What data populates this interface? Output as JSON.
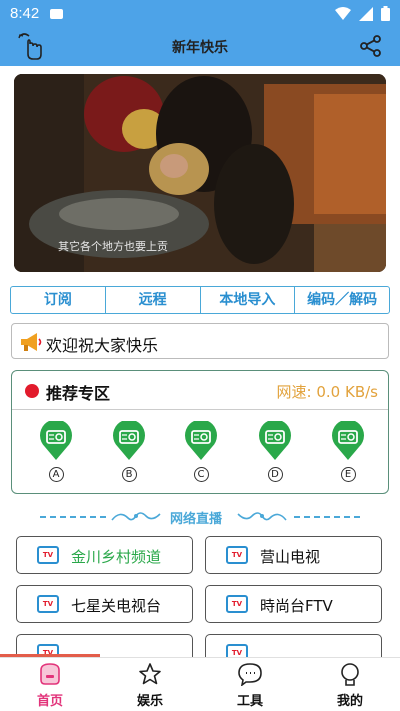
{
  "status": {
    "time": "8:42"
  },
  "app": {
    "title": "新年快乐"
  },
  "video": {
    "subtitle": "其它各个地方也要上贡"
  },
  "tabs": [
    {
      "label": "订阅"
    },
    {
      "label": "远程"
    },
    {
      "label": "本地导入"
    },
    {
      "label": "编码／解码"
    }
  ],
  "notice": {
    "text": "欢迎祝大家快乐"
  },
  "recommend": {
    "title": "推荐专区",
    "speed": "网速: 0.0 KB/s",
    "channels": [
      {
        "letter": "A"
      },
      {
        "letter": "B"
      },
      {
        "letter": "C"
      },
      {
        "letter": "D"
      },
      {
        "letter": "E"
      }
    ]
  },
  "live": {
    "title": "网络直播",
    "channels": [
      {
        "label": "金川乡村频道",
        "active": true
      },
      {
        "label": "营山电视",
        "active": false
      },
      {
        "label": "七星关电视台",
        "active": false
      },
      {
        "label": "時尚台FTV",
        "active": false
      },
      {
        "label": "",
        "active": false
      },
      {
        "label": "",
        "active": false
      }
    ],
    "tv_badge": "TV"
  },
  "nav": [
    {
      "label": "首页",
      "icon": "home-icon",
      "active": true
    },
    {
      "label": "娱乐",
      "icon": "star-icon",
      "active": false
    },
    {
      "label": "工具",
      "icon": "chat-icon",
      "active": false
    },
    {
      "label": "我的",
      "icon": "user-icon",
      "active": false
    }
  ],
  "colors": {
    "accent": "#4da3e8",
    "active_nav": "#e2337a",
    "green": "#2aa84a",
    "speed": "#e2a23c"
  }
}
